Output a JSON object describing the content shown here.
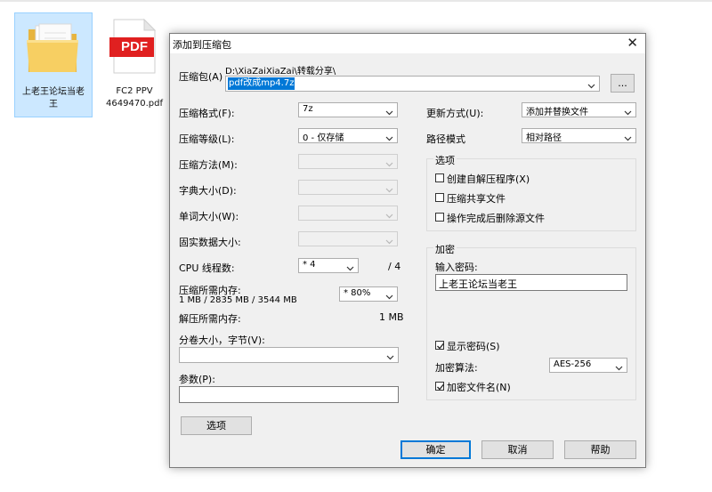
{
  "desktop": {
    "folder_label": "上老王论坛当老王",
    "pdf_badge": "PDF",
    "pdf_label": "FC2 PPV 4649470.pdf"
  },
  "dialog": {
    "title": "添加到压缩包",
    "archive_label": "压缩包(A)",
    "archive_path": "D:\\XiaZaiXiaZai\\转载分享\\",
    "archive_name": "pdf改成mp4.7z",
    "browse_button": "...",
    "format_label": "压缩格式(F):",
    "format_value": "7z",
    "level_label": "压缩等级(L):",
    "level_value": "0 - 仅存储",
    "method_label": "压缩方法(M):",
    "dict_label": "字典大小(D):",
    "word_label": "单词大小(W):",
    "solid_label": "固实数据大小:",
    "cpu_label": "CPU 线程数:",
    "cpu_value": "* 4",
    "cpu_total": "/ 4",
    "mem_comp_label": "压缩所需内存:",
    "mem_comp_detail": "1 MB / 2835 MB / 3544 MB",
    "mem_percent": "* 80%",
    "mem_decomp_label": "解压所需内存:",
    "mem_decomp_value": "1 MB",
    "split_label": "分卷大小，字节(V):",
    "params_label": "参数(P):",
    "options_button": "选项",
    "update_label": "更新方式(U):",
    "update_value": "添加并替换文件",
    "path_mode_label": "路径模式",
    "path_mode_value": "相对路径",
    "options_group": "选项",
    "opt_sfx": "创建自解压程序(X)",
    "opt_shared": "压缩共享文件",
    "opt_delete": "操作完成后删除源文件",
    "encrypt_group": "加密",
    "password_label": "输入密码:",
    "password_value": "上老王论坛当老王",
    "show_password": "显示密码(S)",
    "enc_method_label": "加密算法:",
    "enc_method_value": "AES-256",
    "encrypt_names": "加密文件名(N)",
    "ok_button": "确定",
    "cancel_button": "取消",
    "help_button": "帮助"
  },
  "colors": {
    "selection_blue": "#0078d7",
    "pdf_red": "#e02020",
    "folder_yellow": "#f5c95a"
  }
}
